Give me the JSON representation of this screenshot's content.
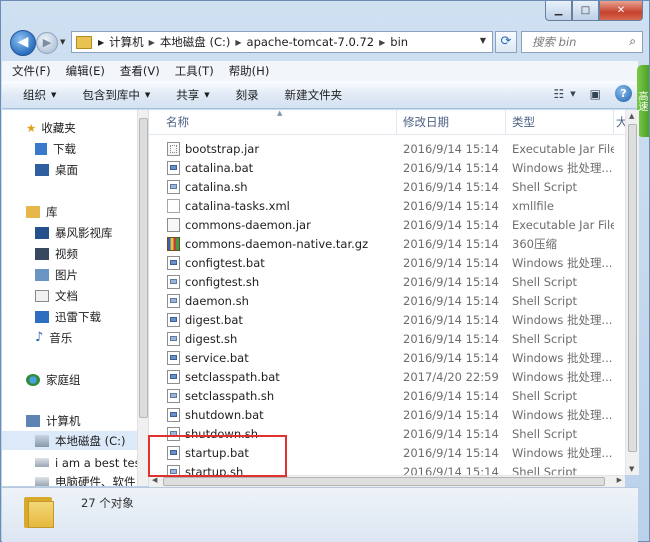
{
  "window": {
    "min_label": "▁",
    "max_label": "□",
    "close_label": "✕"
  },
  "nav": {
    "back_glyph": "◀",
    "forward_glyph": "▶",
    "breadcrumb": [
      "计算机",
      "本地磁盘 (C:)",
      "apache-tomcat-7.0.72",
      "bin"
    ],
    "search_placeholder": "搜索 bin"
  },
  "menu": [
    "文件(F)",
    "编辑(E)",
    "查看(V)",
    "工具(T)",
    "帮助(H)"
  ],
  "toolbar": {
    "organize": "组织",
    "include_in_library": "包含到库中",
    "share": "共享",
    "burn": "刻录",
    "new_folder": "新建文件夹"
  },
  "side_tab_text": "高速",
  "navpane": {
    "favorites": "收藏夹",
    "downloads": "下载",
    "desktop": "桌面",
    "libraries": "库",
    "storm": "暴风影视库",
    "videos": "视频",
    "pictures": "图片",
    "documents": "文档",
    "thunder": "迅雷下载",
    "music": "音乐",
    "homegroup": "家庭组",
    "computer": "计算机",
    "local_disk": "本地磁盘 (C:)",
    "drive2": "i am a  best tes",
    "drive3": "电脑硬件、软件"
  },
  "columns": {
    "name": "名称",
    "date": "修改日期",
    "type": "类型",
    "size": "大"
  },
  "files": [
    {
      "name": "bootstrap.jar",
      "date": "2016/9/14 15:14",
      "type": "Executable Jar File",
      "icon": "jar"
    },
    {
      "name": "catalina.bat",
      "date": "2016/9/14 15:14",
      "type": "Windows 批处理...",
      "icon": "bat"
    },
    {
      "name": "catalina.sh",
      "date": "2016/9/14 15:14",
      "type": "Shell Script",
      "icon": "sh"
    },
    {
      "name": "catalina-tasks.xml",
      "date": "2016/9/14 15:14",
      "type": "xmllfile",
      "icon": "xml"
    },
    {
      "name": "commons-daemon.jar",
      "date": "2016/9/14 15:14",
      "type": "Executable Jar File",
      "icon": "jar2"
    },
    {
      "name": "commons-daemon-native.tar.gz",
      "date": "2016/9/14 15:14",
      "type": "360压缩",
      "icon": "gz"
    },
    {
      "name": "configtest.bat",
      "date": "2016/9/14 15:14",
      "type": "Windows 批处理...",
      "icon": "bat"
    },
    {
      "name": "configtest.sh",
      "date": "2016/9/14 15:14",
      "type": "Shell Script",
      "icon": "sh"
    },
    {
      "name": "daemon.sh",
      "date": "2016/9/14 15:14",
      "type": "Shell Script",
      "icon": "sh"
    },
    {
      "name": "digest.bat",
      "date": "2016/9/14 15:14",
      "type": "Windows 批处理...",
      "icon": "bat"
    },
    {
      "name": "digest.sh",
      "date": "2016/9/14 15:14",
      "type": "Shell Script",
      "icon": "sh"
    },
    {
      "name": "service.bat",
      "date": "2016/9/14 15:14",
      "type": "Windows 批处理...",
      "icon": "bat"
    },
    {
      "name": "setclasspath.bat",
      "date": "2017/4/20 22:59",
      "type": "Windows 批处理...",
      "icon": "bat"
    },
    {
      "name": "setclasspath.sh",
      "date": "2016/9/14 15:14",
      "type": "Shell Script",
      "icon": "sh"
    },
    {
      "name": "shutdown.bat",
      "date": "2016/9/14 15:14",
      "type": "Windows 批处理...",
      "icon": "bat"
    },
    {
      "name": "shutdown.sh",
      "date": "2016/9/14 15:14",
      "type": "Shell Script",
      "icon": "sh"
    },
    {
      "name": "startup.bat",
      "date": "2016/9/14 15:14",
      "type": "Windows 批处理...",
      "icon": "bat"
    },
    {
      "name": "startup.sh",
      "date": "2016/9/14 15:14",
      "type": "Shell Script",
      "icon": "sh"
    }
  ],
  "status": {
    "count": "27 个对象"
  },
  "colors": {
    "highlight": "#e03030",
    "selection": "#dbe9f8"
  }
}
